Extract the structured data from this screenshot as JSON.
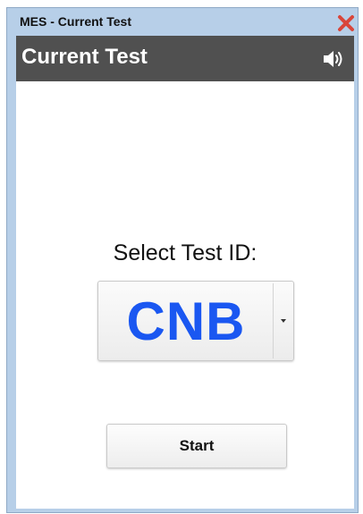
{
  "window": {
    "title": "MES - Current Test",
    "close_icon": "close-icon"
  },
  "header": {
    "title": "Current Test",
    "speaker_icon": "speaker-icon"
  },
  "main": {
    "select_label": "Select Test ID:",
    "test_id": {
      "selected": "CNB",
      "dropdown_icon": "chevron-down-icon"
    },
    "start_label": "Start"
  },
  "colors": {
    "window_frame": "#b7cfe8",
    "app_bar": "#505050",
    "test_id_text": "#1a57f1",
    "close_icon": "#d9463a"
  }
}
